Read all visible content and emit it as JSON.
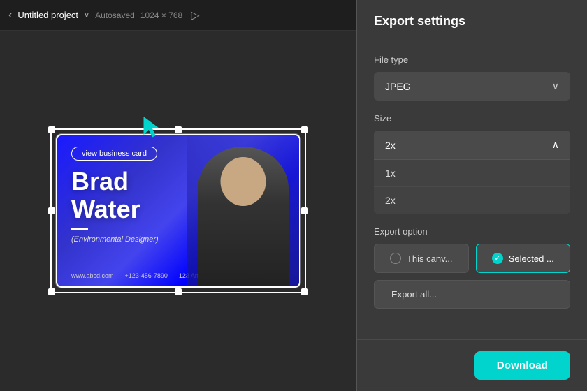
{
  "topbar": {
    "nav_chevron": "‹",
    "project_title": "Untitled project",
    "dropdown_chevron": "∨",
    "autosaved": "Autosaved",
    "resolution": "1024 × 768"
  },
  "canvas": {
    "card": {
      "view_btn": "view business card",
      "name_line1": "Brad",
      "name_line2": "Water",
      "title": "(Environmental Designer)",
      "website": "www.abcd.com",
      "phone": "+123-456-7890",
      "address": "123 An"
    }
  },
  "export_panel": {
    "title": "Export settings",
    "file_type_label": "File type",
    "file_type_value": "JPEG",
    "file_type_chevron": "∨",
    "size_label": "Size",
    "size_value": "2x",
    "size_chevron": "∧",
    "size_options": [
      {
        "label": "1x"
      },
      {
        "label": "2x"
      }
    ],
    "export_option_label": "Export option",
    "options": [
      {
        "id": "this-canvas",
        "label": "This canv...",
        "selected": false
      },
      {
        "id": "selected",
        "label": "Selected ...",
        "selected": true
      }
    ],
    "export_all_label": "Export all...",
    "download_label": "Download"
  },
  "colors": {
    "teal": "#00d4cc",
    "panel_bg": "#3a3a3a",
    "item_bg": "#4a4a4a",
    "text_primary": "#ffffff",
    "text_secondary": "#cccccc",
    "border": "#555555"
  }
}
